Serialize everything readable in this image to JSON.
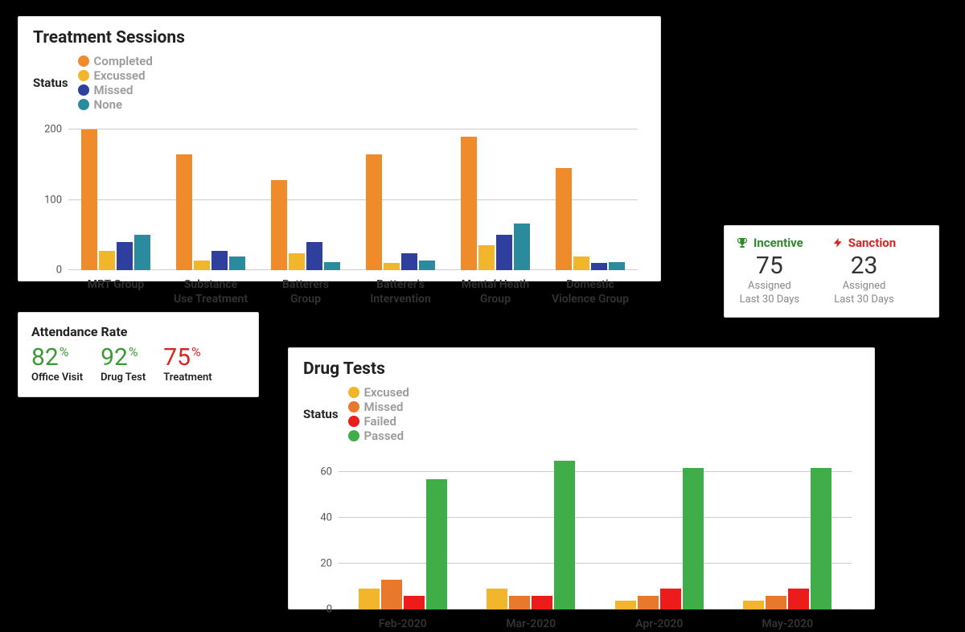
{
  "colors": {
    "orange": "#f08b2c",
    "gold": "#f2b62c",
    "blue": "#2e3f9e",
    "teal": "#2a8a9e",
    "orange2": "#e8782c",
    "red": "#ec1c1c",
    "green": "#3fae49"
  },
  "treatment": {
    "title": "Treatment Sessions",
    "legend_title": "Status",
    "legend": [
      {
        "label": "Completed",
        "colorKey": "orange"
      },
      {
        "label": "Excussed",
        "colorKey": "gold"
      },
      {
        "label": "Missed",
        "colorKey": "blue"
      },
      {
        "label": "None",
        "colorKey": "teal"
      }
    ]
  },
  "attendance": {
    "title": "Attendance Rate",
    "items": [
      {
        "value": "82",
        "suffix": "%",
        "label": "Office Visit",
        "colorKey": "green"
      },
      {
        "value": "92",
        "suffix": "%",
        "label": "Drug Test",
        "colorKey": "green"
      },
      {
        "value": "75",
        "suffix": "%",
        "label": "Treatment",
        "colorKey": "red"
      }
    ]
  },
  "incentive_sanction": {
    "items": [
      {
        "icon": "trophy",
        "label": "Incentive",
        "value": "75",
        "sub1": "Assigned",
        "sub2": "Last 30 Days",
        "colorKey": "green"
      },
      {
        "icon": "bolt",
        "label": "Sanction",
        "value": "23",
        "sub1": "Assigned",
        "sub2": "Last 30 Days",
        "colorKey": "red"
      }
    ]
  },
  "drugtests": {
    "title": "Drug Tests",
    "legend_title": "Status",
    "legend": [
      {
        "label": "Excused",
        "colorKey": "gold"
      },
      {
        "label": "Missed",
        "colorKey": "orange2"
      },
      {
        "label": "Failed",
        "colorKey": "red"
      },
      {
        "label": "Passed",
        "colorKey": "green"
      }
    ]
  },
  "chart_data": [
    {
      "id": "treatment_sessions",
      "type": "bar",
      "title": "Treatment Sessions",
      "ylabel": "",
      "xlabel": "",
      "ylim": [
        0,
        200
      ],
      "yticks": [
        0,
        100,
        200
      ],
      "categories": [
        "MRT Group",
        "Substance\nUse Treatment",
        "Batterers\nGroup",
        "Batterer's\nIntervention",
        "Mental Heath\nGroup",
        "Domestic\nViolence Group"
      ],
      "series": [
        {
          "name": "Completed",
          "colorKey": "orange",
          "values": [
            200,
            165,
            128,
            165,
            190,
            145
          ]
        },
        {
          "name": "Excussed",
          "colorKey": "gold",
          "values": [
            28,
            14,
            24,
            10,
            35,
            20
          ]
        },
        {
          "name": "Missed",
          "colorKey": "blue",
          "values": [
            40,
            28,
            40,
            24,
            50,
            10
          ]
        },
        {
          "name": "None",
          "colorKey": "teal",
          "values": [
            50,
            20,
            12,
            14,
            66,
            12
          ]
        }
      ]
    },
    {
      "id": "drug_tests",
      "type": "bar",
      "title": "Drug Tests",
      "ylabel": "",
      "xlabel": "",
      "ylim": [
        0,
        65
      ],
      "yticks": [
        0,
        20,
        40,
        60
      ],
      "categories": [
        "Feb-2020",
        "Mar-2020",
        "Apr-2020",
        "May-2020"
      ],
      "series": [
        {
          "name": "Excused",
          "colorKey": "gold",
          "values": [
            9,
            9,
            4,
            4
          ]
        },
        {
          "name": "Missed",
          "colorKey": "orange2",
          "values": [
            13,
            6,
            6,
            6
          ]
        },
        {
          "name": "Failed",
          "colorKey": "red",
          "values": [
            6,
            6,
            9,
            9
          ]
        },
        {
          "name": "Passed",
          "colorKey": "green",
          "values": [
            57,
            65,
            62,
            62
          ]
        }
      ]
    }
  ]
}
